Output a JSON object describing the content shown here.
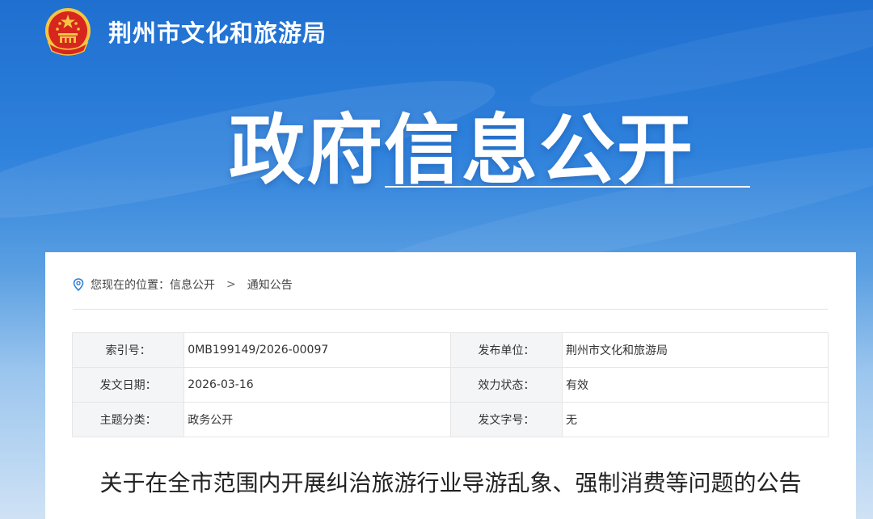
{
  "header": {
    "org_name": "荆州市文化和旅游局",
    "emblem_icon": "national-emblem-icon"
  },
  "hero": {
    "title": "政府信息公开"
  },
  "breadcrumb": {
    "icon": "location-pin-icon",
    "prefix": "您现在的位置：",
    "items": [
      "信息公开",
      "通知公告"
    ],
    "separator": ">"
  },
  "meta": {
    "rows": [
      {
        "label1": "索引号：",
        "value1": "0MB199149/2026-00097",
        "label2": "发布单位：",
        "value2": "荆州市文化和旅游局"
      },
      {
        "label1": "发文日期：",
        "value1": "2026-03-16",
        "label2": "效力状态：",
        "value2": "有效"
      },
      {
        "label1": "主题分类：",
        "value1": "政务公开",
        "label2": "发文字号：",
        "value2": "无"
      }
    ]
  },
  "article": {
    "title": "关于在全市范围内开展纠治旅游行业导游乱象、强制消费等问题的公告"
  },
  "colors": {
    "banner_top": "#1f6fd0",
    "banner_bottom": "#cfe2f5",
    "emblem_red": "#d7261e",
    "emblem_gold": "#f5c542",
    "pin_blue": "#2f7fd6"
  }
}
